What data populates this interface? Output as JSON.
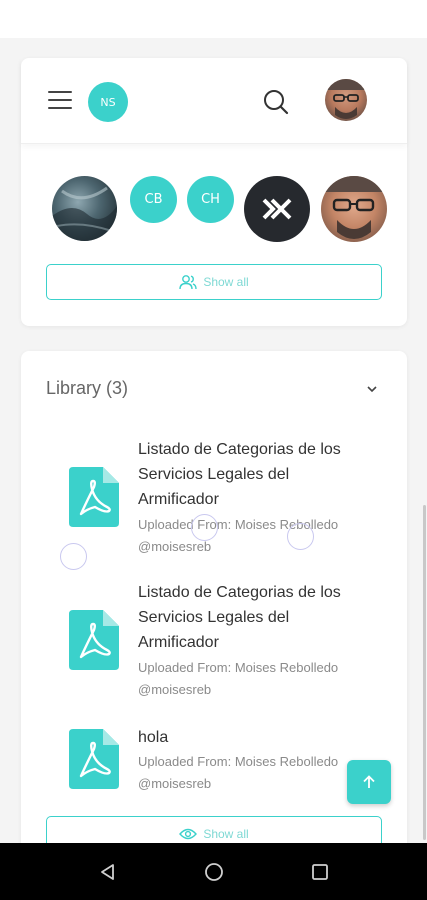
{
  "header": {
    "user_initials": "NS"
  },
  "members": [
    {
      "kind": "photo",
      "name": "aerial-photo-avatar"
    },
    {
      "kind": "initials",
      "initials": "CB"
    },
    {
      "kind": "initials",
      "initials": "CH"
    },
    {
      "kind": "logo",
      "name": "dark-logo-avatar"
    },
    {
      "kind": "photo",
      "name": "man-glasses-avatar"
    }
  ],
  "members_show_all_label": "Show all",
  "library": {
    "title": "Library (3)",
    "items": [
      {
        "title_lines": [
          "Listado de Categorias de los",
          "Servicios Legales del",
          "Armificador"
        ],
        "uploaded_from": "Uploaded From: Moises Rebolledo",
        "handle": "@moisesreb"
      },
      {
        "title_lines": [
          "Listado de Categorias de los",
          "Servicios Legales del",
          "Armificador"
        ],
        "uploaded_from": "Uploaded From: Moises Rebolledo",
        "handle": "@moisesreb"
      },
      {
        "title_lines": [
          "hola"
        ],
        "uploaded_from": "Uploaded From: Moises Rebolledo",
        "handle": "@moisesreb"
      }
    ],
    "show_all_label": "Show all"
  },
  "colors": {
    "accent": "#3bd1cb",
    "dark_logo": "#26292e",
    "nav_bar": "#000000"
  },
  "icons": {
    "menu": "hamburger-menu-icon",
    "search": "search-icon",
    "users": "users-icon",
    "eye": "eye-icon",
    "pdf": "pdf-file-icon",
    "chevron": "chevron-down-icon",
    "arrow_up": "arrow-up-icon"
  }
}
